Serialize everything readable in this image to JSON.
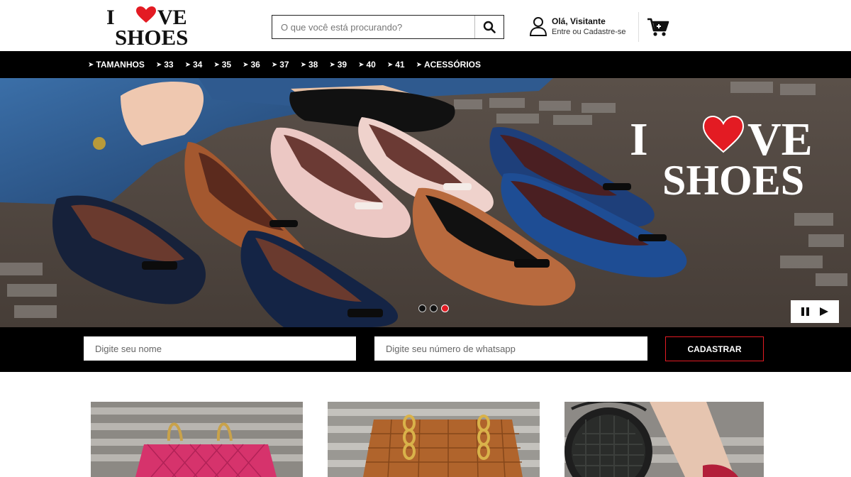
{
  "brand": {
    "logo_text_top": "I",
    "logo_text_love": "VE",
    "logo_text_bottom": "SHOES",
    "accent_color": "#e31b23"
  },
  "header": {
    "search": {
      "placeholder": "O que você está procurando?",
      "icon": "search-icon"
    },
    "account": {
      "greeting": "Olá, Visitante",
      "login_link": "Entre ou Cadastre-se",
      "icon": "user-icon"
    },
    "cart": {
      "icon": "cart-icon"
    }
  },
  "nav": {
    "items": [
      {
        "label": "TAMANHOS"
      },
      {
        "label": "33"
      },
      {
        "label": "34"
      },
      {
        "label": "35"
      },
      {
        "label": "36"
      },
      {
        "label": "37"
      },
      {
        "label": "38"
      },
      {
        "label": "39"
      },
      {
        "label": "40"
      },
      {
        "label": "41"
      },
      {
        "label": "ACESSÓRIOS"
      }
    ]
  },
  "banner": {
    "slides_count": 3,
    "active_slide": 3,
    "controls": {
      "pause_icon": "pause-icon",
      "play_icon": "play-icon"
    }
  },
  "signup": {
    "name_placeholder": "Digite seu nome",
    "whatsapp_placeholder": "Digite seu número de whatsapp",
    "submit_label": "CADASTRAR"
  },
  "products": [
    {
      "image": "pink quilted handbag",
      "color": "#d6336c"
    },
    {
      "image": "brown quilted handbag with chain",
      "color": "#b0642c"
    },
    {
      "image": "black round crossbody bag",
      "color": "#1e1e1e"
    }
  ]
}
